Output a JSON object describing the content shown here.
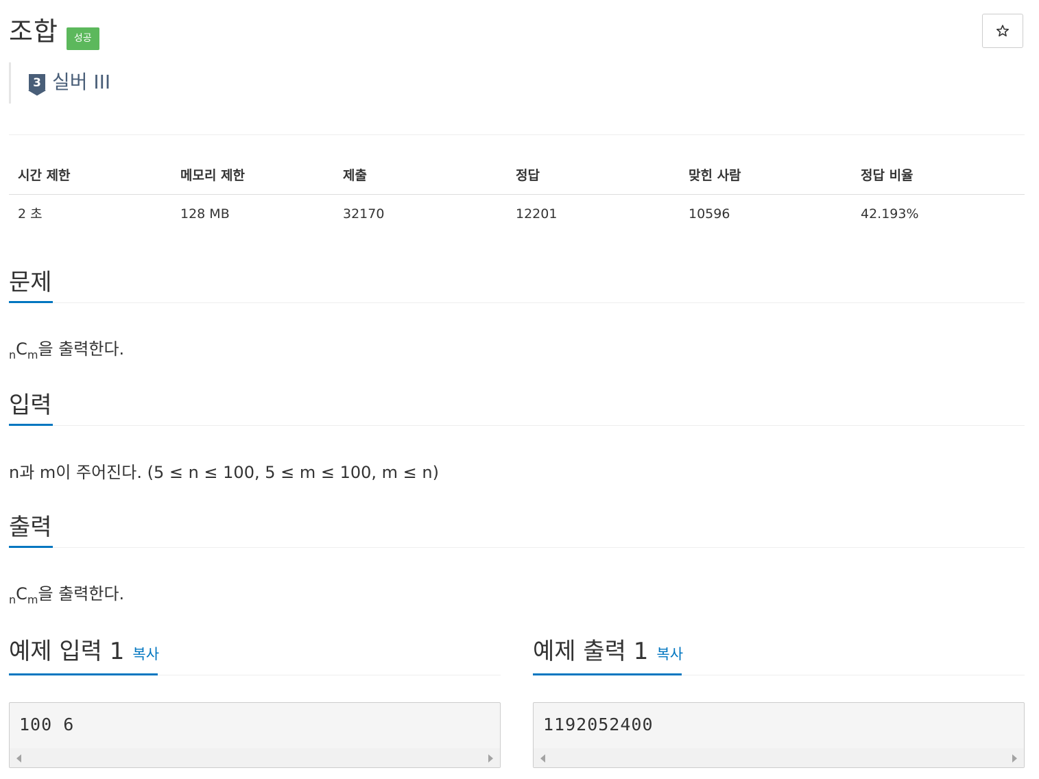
{
  "problem": {
    "title": "조합",
    "status_badge": "성공",
    "tier_number": "3",
    "tier_label": "실버 III",
    "star_icon": "star-outline-icon"
  },
  "info": {
    "headers": [
      "시간 제한",
      "메모리 제한",
      "제출",
      "정답",
      "맞힌 사람",
      "정답 비율"
    ],
    "values": [
      "2 초",
      "128 MB",
      "32170",
      "12201",
      "10596",
      "42.193%"
    ]
  },
  "sections": {
    "description": {
      "heading": "문제",
      "sub_n": "n",
      "c_letter": "C",
      "sub_m": "m",
      "rest": "을 출력한다."
    },
    "input": {
      "heading": "입력",
      "text": "n과 m이 주어진다. (5 ≤ n ≤ 100, 5 ≤ m ≤ 100, m ≤ n)"
    },
    "output": {
      "heading": "출력",
      "sub_n": "n",
      "c_letter": "C",
      "sub_m": "m",
      "rest": "을 출력한다."
    }
  },
  "samples": {
    "input": {
      "heading": "예제 입력 1",
      "copy_label": "복사",
      "content": "100 6"
    },
    "output": {
      "heading": "예제 출력 1",
      "copy_label": "복사",
      "content": "1192052400"
    }
  },
  "colors": {
    "accent": "#0076c0",
    "success": "#5cb85c",
    "tier_silver": "#495e78"
  }
}
